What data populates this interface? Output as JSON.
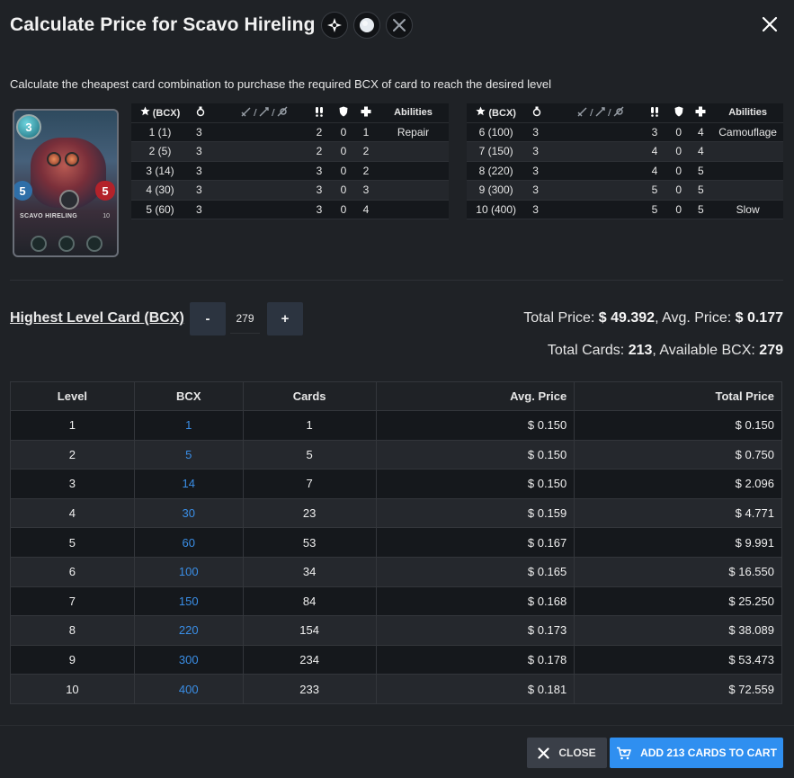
{
  "header": {
    "title": "Calculate Price for Scavo Hireling",
    "icons": [
      "neutral-element-icon",
      "common-rarity-icon",
      "no-attack-icon",
      "close-icon"
    ]
  },
  "subtitle": "Calculate the cheapest card combination to purchase the required BCX of card to reach the desired level",
  "card": {
    "name": "SCAVO HIRELING",
    "mana": "3",
    "speed": "5",
    "health": "5",
    "level": "10"
  },
  "stats": {
    "headers": {
      "bcx": "(BCX)",
      "abilities": "Abilities"
    },
    "left": [
      {
        "bcx": "1 (1)",
        "mana": "3",
        "speed": "2",
        "armor": "0",
        "health": "1",
        "ability": "Repair"
      },
      {
        "bcx": "2 (5)",
        "mana": "3",
        "speed": "2",
        "armor": "0",
        "health": "2",
        "ability": ""
      },
      {
        "bcx": "3 (14)",
        "mana": "3",
        "speed": "3",
        "armor": "0",
        "health": "2",
        "ability": ""
      },
      {
        "bcx": "4 (30)",
        "mana": "3",
        "speed": "3",
        "armor": "0",
        "health": "3",
        "ability": ""
      },
      {
        "bcx": "5 (60)",
        "mana": "3",
        "speed": "3",
        "armor": "0",
        "health": "4",
        "ability": ""
      }
    ],
    "right": [
      {
        "bcx": "6 (100)",
        "mana": "3",
        "speed": "3",
        "armor": "0",
        "health": "4",
        "ability": "Camouflage"
      },
      {
        "bcx": "7 (150)",
        "mana": "3",
        "speed": "4",
        "armor": "0",
        "health": "4",
        "ability": ""
      },
      {
        "bcx": "8 (220)",
        "mana": "3",
        "speed": "4",
        "armor": "0",
        "health": "5",
        "ability": ""
      },
      {
        "bcx": "9 (300)",
        "mana": "3",
        "speed": "5",
        "armor": "0",
        "health": "5",
        "ability": ""
      },
      {
        "bcx": "10 (400)",
        "mana": "3",
        "speed": "5",
        "armor": "0",
        "health": "5",
        "ability": "Slow"
      }
    ]
  },
  "controls": {
    "label": "Highest Level Card (BCX)",
    "minus": "-",
    "plus": "+",
    "value": "279"
  },
  "totals": {
    "total_price_label": "Total Price:",
    "total_price": "$ 49.392",
    "avg_price_label": ", Avg. Price:",
    "avg_price": "$ 0.177",
    "total_cards_label": "Total Cards:",
    "total_cards": "213",
    "available_bcx_label": ", Available BCX:",
    "available_bcx": "279"
  },
  "table": {
    "headers": [
      "Level",
      "BCX",
      "Cards",
      "Avg. Price",
      "Total Price"
    ],
    "rows": [
      [
        "1",
        "1",
        "1",
        "$ 0.150",
        "$ 0.150"
      ],
      [
        "2",
        "5",
        "5",
        "$ 0.150",
        "$ 0.750"
      ],
      [
        "3",
        "14",
        "7",
        "$ 0.150",
        "$ 2.096"
      ],
      [
        "4",
        "30",
        "23",
        "$ 0.159",
        "$ 4.771"
      ],
      [
        "5",
        "60",
        "53",
        "$ 0.167",
        "$ 9.991"
      ],
      [
        "6",
        "100",
        "34",
        "$ 0.165",
        "$ 16.550"
      ],
      [
        "7",
        "150",
        "84",
        "$ 0.168",
        "$ 25.250"
      ],
      [
        "8",
        "220",
        "154",
        "$ 0.173",
        "$ 38.089"
      ],
      [
        "9",
        "300",
        "234",
        "$ 0.178",
        "$ 53.473"
      ],
      [
        "10",
        "400",
        "233",
        "$ 0.181",
        "$ 72.559"
      ]
    ]
  },
  "footer": {
    "close_label": "CLOSE",
    "cart_label": "ADD 213 CARDS TO CART"
  },
  "colors": {
    "background": "#1f2226",
    "accent": "#2f8ff0",
    "link": "#3a8ee6"
  }
}
